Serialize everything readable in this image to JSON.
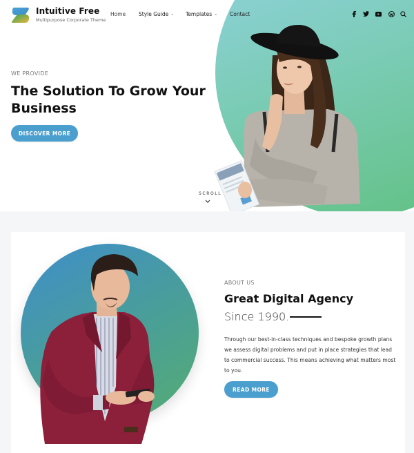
{
  "header": {
    "brand_title": "Intuitive Free",
    "brand_subtitle": "Multipurpose Corporate Theme",
    "nav": [
      {
        "label": "Home",
        "has_dropdown": false
      },
      {
        "label": "Style Guide",
        "has_dropdown": true
      },
      {
        "label": "Templates",
        "has_dropdown": true
      },
      {
        "label": "Contact",
        "has_dropdown": false
      }
    ],
    "dropdown_glyph": "⌄",
    "social_icons": [
      "facebook-icon",
      "twitter-icon",
      "youtube-icon",
      "wordpress-icon",
      "search-icon"
    ]
  },
  "hero": {
    "eyebrow": "WE PROVIDE",
    "title": "The Solution To Grow Your Business",
    "cta_label": "DISCOVER MORE",
    "scroll_label": "SCROLL",
    "image_alt": "Woman in black hat holding brochure"
  },
  "about": {
    "eyebrow": "ABOUT US",
    "title": "Great Digital Agency",
    "since": "Since 1990.",
    "body": "Through our best-in-class techniques and bespoke growth plans we assess digital problems and put in place strategies that lead to commercial success. This means achieving what matters most to you.",
    "cta_label": "READ MORE",
    "image_alt": "Man in red blazer looking at phone"
  },
  "colors": {
    "accent": "#4a9fcf",
    "hero_gradient_start": "#92d3e4",
    "hero_gradient_end": "#5fc07f",
    "about_gradient_start": "#3f8ecb",
    "about_gradient_end": "#55ad72",
    "page_bg": "#f5f6f8"
  }
}
